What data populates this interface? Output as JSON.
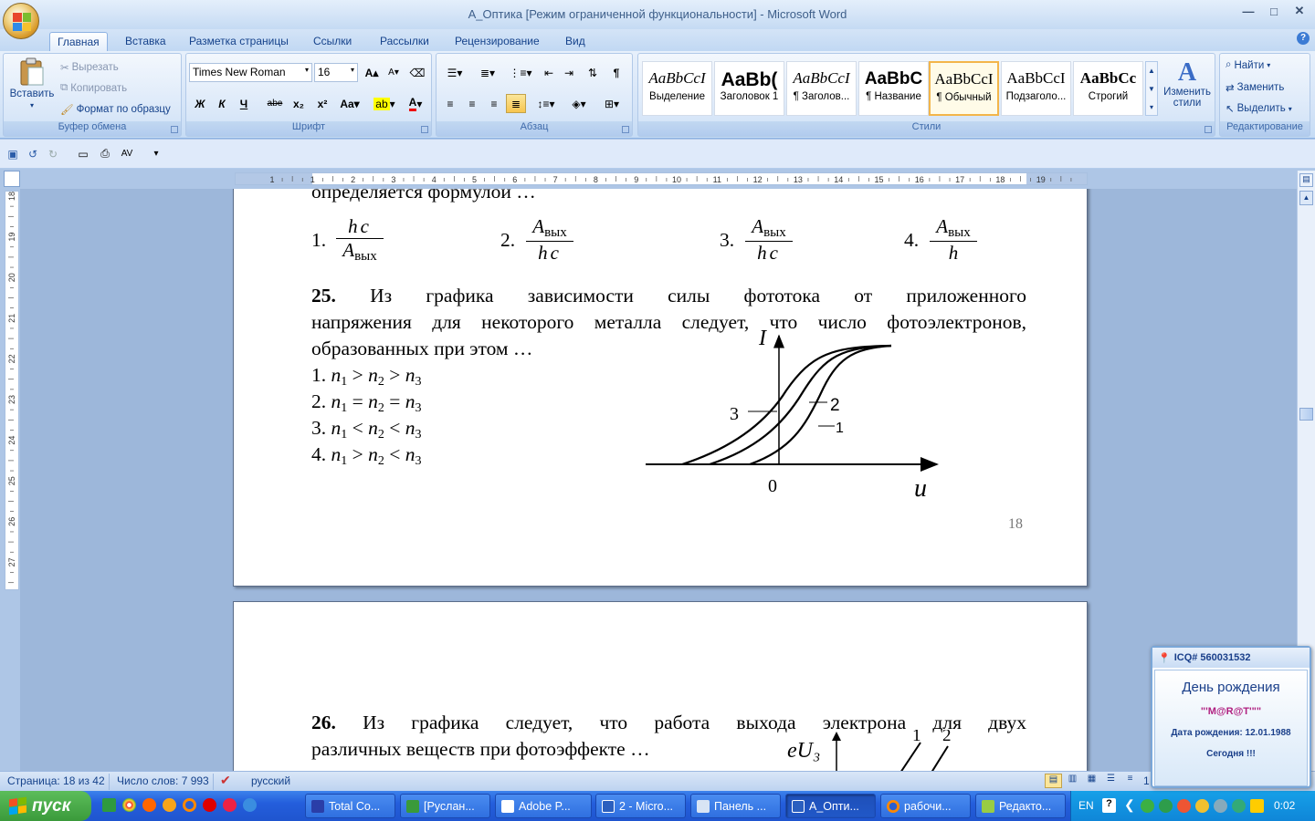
{
  "window": {
    "title": "А_Оптика [Режим ограниченной функциональности] - Microsoft Word",
    "buttons": {
      "minimize": "—",
      "maximize": "□",
      "close": "✕"
    }
  },
  "tabs": [
    "Главная",
    "Вставка",
    "Разметка страницы",
    "Ссылки",
    "Рассылки",
    "Рецензирование",
    "Вид"
  ],
  "ribbon": {
    "clipboard": {
      "paste": "Вставить",
      "cut": "Вырезать",
      "copy": "Копировать",
      "format_painter": "Формат по образцу",
      "label": "Буфер обмена"
    },
    "font": {
      "name": "Times New Roman",
      "size": "16",
      "label": "Шрифт",
      "bold": "Ж",
      "italic": "К",
      "underline": "Ч",
      "strike": "abe",
      "sub": "x₂",
      "sup": "x²",
      "case": "Aa",
      "grow": "A",
      "shrink": "A"
    },
    "paragraph": {
      "label": "Абзац"
    },
    "styles": {
      "label": "Стили",
      "items": [
        {
          "preview": "AaBbCcI",
          "name": "Выделение"
        },
        {
          "preview": "AaBb(",
          "name": "Заголовок 1"
        },
        {
          "preview": "AaBbCcI",
          "name": "¶ Заголов..."
        },
        {
          "preview": "AaBbC",
          "name": "¶ Название"
        },
        {
          "preview": "AaBbCcI",
          "name": "¶ Обычный"
        },
        {
          "preview": "AaBbCcI",
          "name": "Подзаголо..."
        },
        {
          "preview": "AaBbCc",
          "name": "Строгий"
        }
      ],
      "change_styles": "Изменить стили"
    },
    "editing": {
      "find": "Найти",
      "replace": "Заменить",
      "select": "Выделить",
      "label": "Редактирование"
    }
  },
  "hruler_ticks": [
    "1",
    "1",
    "2",
    "3",
    "4",
    "5",
    "6",
    "7",
    "8",
    "9",
    "10",
    "11",
    "12",
    "13",
    "14",
    "15",
    "16",
    "17",
    "18",
    "19"
  ],
  "vruler_ticks": [
    "18",
    "19",
    "20",
    "21",
    "22",
    "23",
    "24",
    "25",
    "26",
    "27"
  ],
  "document": {
    "page1": {
      "top_line": "определяется формулой …",
      "options": [
        {
          "n": "1.",
          "num": "hc",
          "den": "Aвых"
        },
        {
          "n": "2.",
          "num": "Aвых",
          "den": "hc"
        },
        {
          "n": "3.",
          "num": "Aвых",
          "den": "hc"
        },
        {
          "n": "4.",
          "num": "Aвых",
          "den": "h"
        }
      ],
      "q25_num": "25.",
      "q25_line1": "Из графика зависимости силы фототока от приложенного",
      "q25_line2": "напряжения для некоторого металла следует, что число фотоэлектронов,",
      "q25_line3": "образованных при этом …",
      "answers": [
        "1. n1 > n2 > n3",
        "2. n1 = n2 = n3",
        "3. n1 < n2 < n3",
        "4. n1 > n2 < n3"
      ],
      "graph": {
        "y_label": "I",
        "x_label": "u",
        "origin": "0",
        "curve_labels": [
          "3",
          "2",
          "1"
        ]
      },
      "page_number": "18"
    },
    "page2": {
      "q26_num": "26.",
      "q26_line1": "Из графика следует, что работа выхода электрона для двух",
      "q26_line2": "различных веществ при фотоэффекте …",
      "graph_label": "eU₃",
      "curve_labels": [
        "1",
        "2"
      ]
    }
  },
  "status": {
    "page": "Страница: 18 из 42",
    "words": "Число слов: 7 993",
    "language": "русский",
    "zoom": "1"
  },
  "taskbar": {
    "start": "пуск",
    "tasks": [
      "Total Co...",
      "[Руслан...",
      "Adobe P...",
      "2 - Micro...",
      "Панель ...",
      "А_Опти...",
      "рабочи...",
      "Редакто..."
    ],
    "lang": "EN",
    "clock": "0:02"
  },
  "icq": {
    "header": "ICQ# 560031532",
    "title": "День рождения",
    "name": "\"'M@R@T'\"\"",
    "birth": "Дата рождения: 12.01.1988",
    "today": "Сегодня !!!"
  },
  "colors": {
    "ribbon_text": "#15428b",
    "taskbar": "#245edc",
    "start": "#3b9a3b",
    "selected_style": "#f3b54a"
  }
}
